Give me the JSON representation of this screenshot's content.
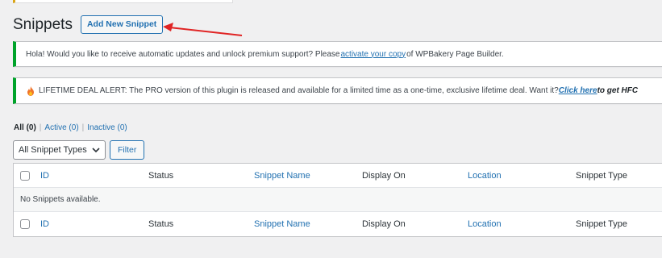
{
  "page": {
    "title": "Snippets",
    "add_new_label": "Add New Snippet"
  },
  "notices": {
    "wpbakery": {
      "before": "Hola! Would you like to receive automatic updates and unlock premium support? Please ",
      "link": "activate your copy",
      "after": " of WPBakery Page Builder."
    },
    "lifetime": {
      "text": "LIFETIME DEAL ALERT: The PRO version of this plugin is released and available for a limited time as a one-time, exclusive lifetime deal. Want it? ",
      "link": "Click here",
      "tail": " to get HFC"
    }
  },
  "views": {
    "all": {
      "label": "All",
      "count": "(0)"
    },
    "active": {
      "label": "Active",
      "count": "(0)"
    },
    "inactive": {
      "label": "Inactive",
      "count": "(0)"
    },
    "separator": "|"
  },
  "filters": {
    "type_select_value": "All Snippet Types",
    "filter_label": "Filter"
  },
  "table": {
    "columns": [
      "ID",
      "Status",
      "Snippet Name",
      "Display On",
      "Location",
      "Snippet Type"
    ],
    "empty_message": "No Snippets available."
  },
  "colors": {
    "accent": "#2271b1",
    "success_border": "#00a32a",
    "arrow": "#e02424"
  }
}
